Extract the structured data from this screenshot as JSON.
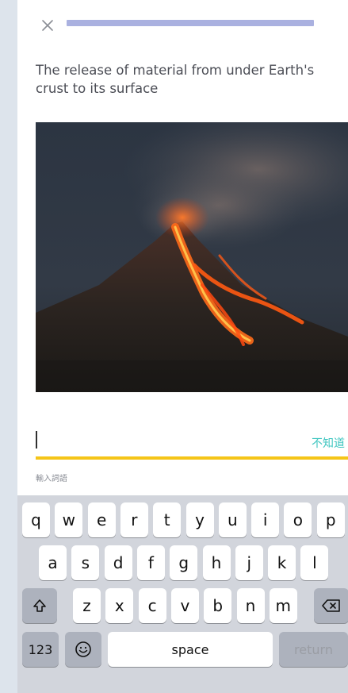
{
  "quiz": {
    "progress_fraction": 1.0,
    "prompt_text": "The release of material from under Earth's crust to its surface",
    "image_subject": "volcano-eruption",
    "answer_value": "",
    "dont_know_label": "不知道",
    "input_hint": "輸入詞語"
  },
  "keyboard": {
    "row1": [
      "q",
      "w",
      "e",
      "r",
      "t",
      "y",
      "u",
      "i",
      "o",
      "p"
    ],
    "row2": [
      "a",
      "s",
      "d",
      "f",
      "g",
      "h",
      "j",
      "k",
      "l"
    ],
    "row3": [
      "z",
      "x",
      "c",
      "v",
      "b",
      "n",
      "m"
    ],
    "numbers_label": "123",
    "space_label": "space",
    "return_label": "return"
  },
  "icons": {
    "close": "close-icon",
    "shift": "shift-icon",
    "backspace": "backspace-icon",
    "emoji": "emoji-icon"
  },
  "colors": {
    "progress": "#aab1e0",
    "underline": "#f5c518",
    "dont_know": "#3fc6c0",
    "keyboard_bg": "#d2d5dc"
  }
}
